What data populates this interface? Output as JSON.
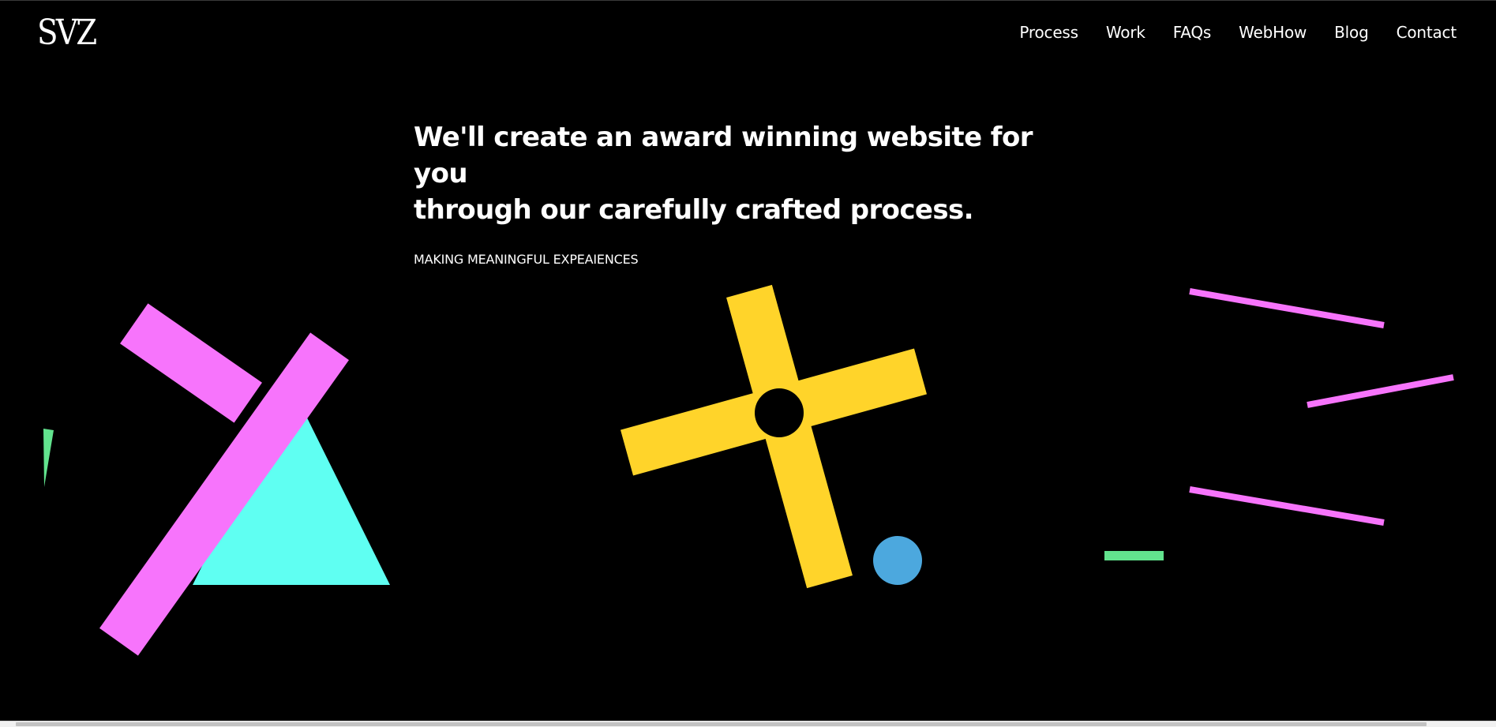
{
  "logo": {
    "text": "SVZ"
  },
  "nav": {
    "items": [
      {
        "label": "Process"
      },
      {
        "label": "Work"
      },
      {
        "label": "FAQs"
      },
      {
        "label": "WebHow"
      },
      {
        "label": "Blog"
      },
      {
        "label": "Contact"
      }
    ]
  },
  "hero": {
    "headline_line1": "We'll create an award winning website for you",
    "headline_line2": "through our carefully crafted process.",
    "subtitle": "MAKING MEANINGFUL EXPEAIENCES"
  },
  "colors": {
    "background": "#000000",
    "magenta": "#F774FC",
    "cyan": "#5FFFF2",
    "yellow": "#FFD42A",
    "blue": "#4CA8DE",
    "green": "#62E38E"
  }
}
